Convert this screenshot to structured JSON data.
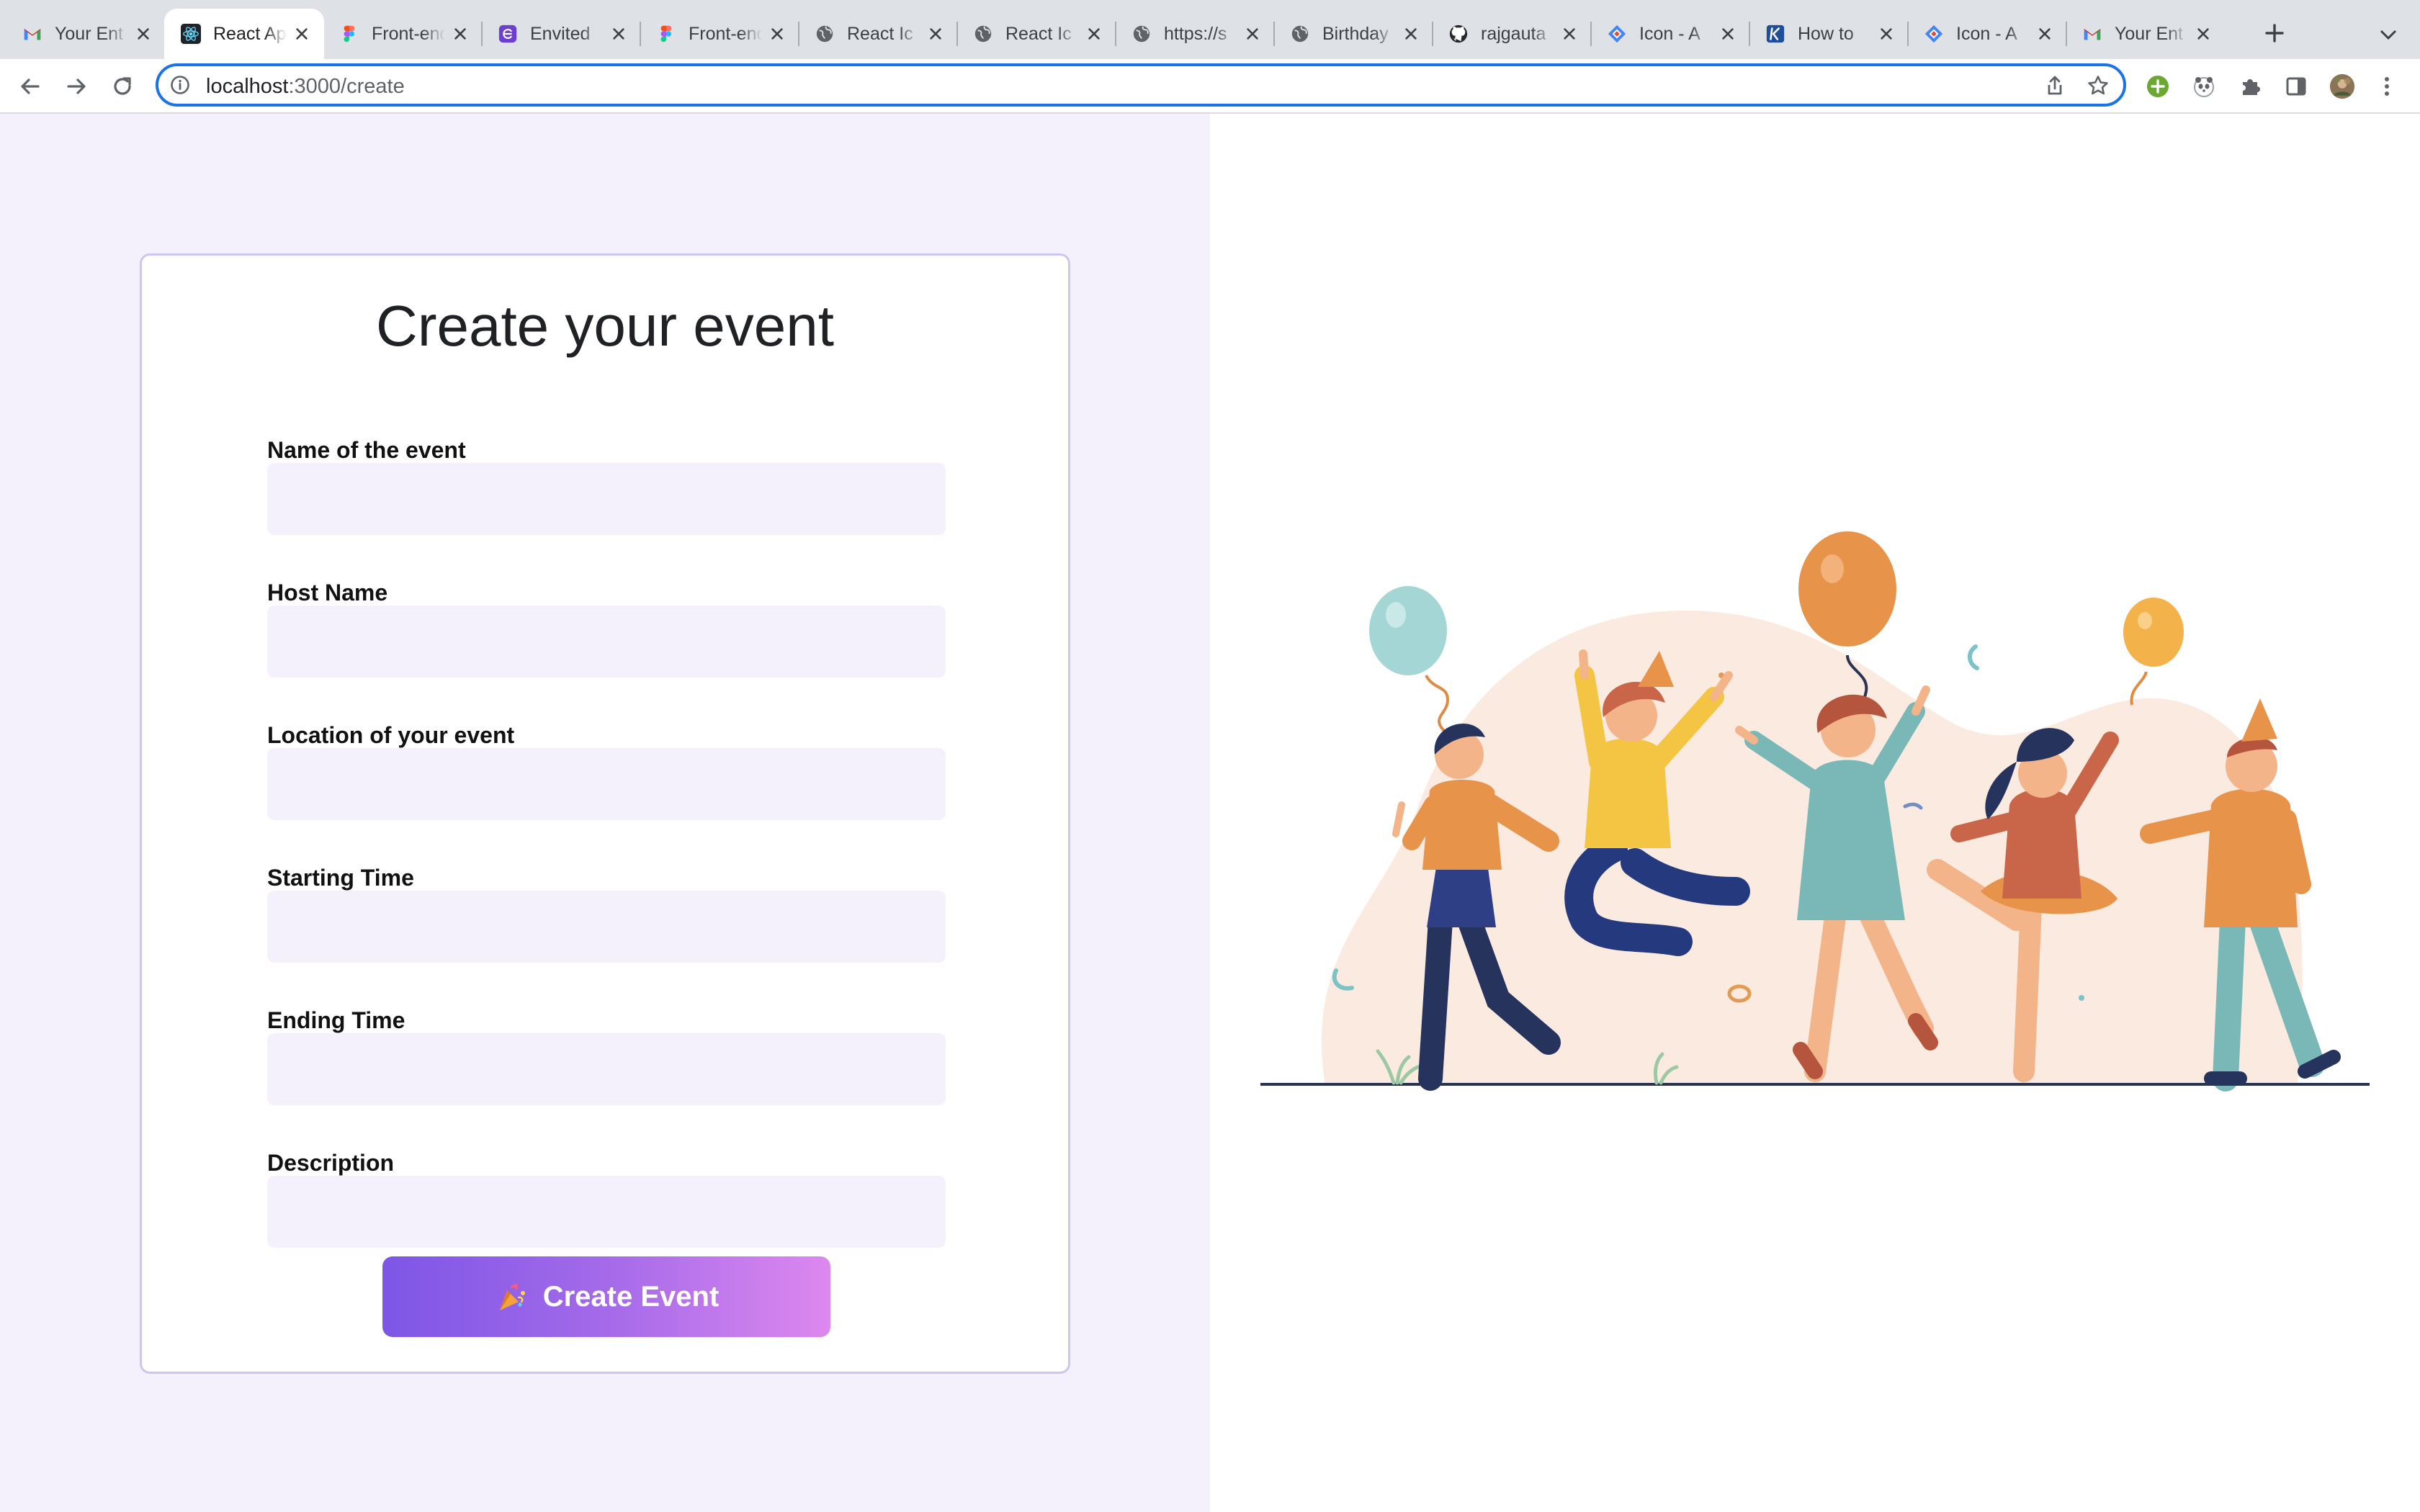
{
  "browser": {
    "tabs": [
      {
        "title": "Your Ent",
        "icon": "gmail-icon",
        "active": false
      },
      {
        "title": "React App",
        "icon": "react-icon",
        "active": true
      },
      {
        "title": "Front-end",
        "icon": "figma-icon",
        "active": false
      },
      {
        "title": "Envited",
        "icon": "envited-icon",
        "active": false
      },
      {
        "title": "Front-end",
        "icon": "figma-icon",
        "active": false
      },
      {
        "title": "React Ic",
        "icon": "globe-icon",
        "active": false
      },
      {
        "title": "React Ic",
        "icon": "globe-icon",
        "active": false
      },
      {
        "title": "https://s",
        "icon": "globe-icon",
        "active": false
      },
      {
        "title": "Birthday",
        "icon": "globe-icon",
        "active": false
      },
      {
        "title": "rajgauta",
        "icon": "github-icon",
        "active": false
      },
      {
        "title": "Icon - A",
        "icon": "diamond-icon",
        "active": false
      },
      {
        "title": "How to",
        "icon": "k-icon",
        "active": false
      },
      {
        "title": "Icon - A",
        "icon": "diamond-icon",
        "active": false
      },
      {
        "title": "Your Ent",
        "icon": "gmail-icon",
        "active": false
      }
    ],
    "address": {
      "host": "localhost",
      "path": ":3000/create"
    },
    "colors": {
      "accent": "#1a73e8",
      "tabstrip": "#dee1e6"
    }
  },
  "form": {
    "title": "Create your event",
    "fields": [
      {
        "label": "Name of the event",
        "value": ""
      },
      {
        "label": "Host Name",
        "value": ""
      },
      {
        "label": "Location of your event",
        "value": ""
      },
      {
        "label": "Starting Time",
        "value": ""
      },
      {
        "label": "Ending Time",
        "value": ""
      },
      {
        "label": "Description",
        "value": ""
      }
    ],
    "submit_label": "Create Event",
    "submit_icon": "confetti-icon",
    "colors": {
      "panel": "#f4f1fc",
      "field": "#f4f1fc",
      "button_start": "#7d56e6",
      "button_end": "#dd88ee"
    }
  },
  "illustration": {
    "icon": "party-people-illustration"
  }
}
